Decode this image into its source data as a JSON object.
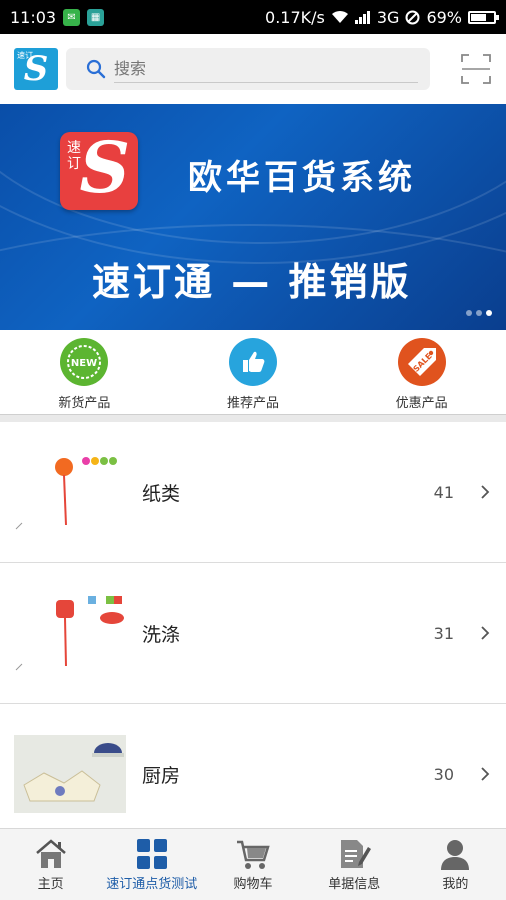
{
  "status_bar": {
    "time": "11:03",
    "speed": "0.17K/s",
    "network": "3G",
    "battery_text": "69%",
    "battery_level": 0.69
  },
  "header": {
    "logo_small": "速订",
    "logo_letter": "S",
    "search_placeholder": "搜索"
  },
  "banner": {
    "logo_small": "速订",
    "logo_letter": "S",
    "title": "欧华百货系统",
    "subtitle": "速订通 — 推销版",
    "active_slide": 2
  },
  "categories": [
    {
      "label": "新货产品",
      "badge": "NEW",
      "color": "#5cb531"
    },
    {
      "label": "推荐产品",
      "badge": "thumbs-up",
      "color": "#27a4dd"
    },
    {
      "label": "优惠产品",
      "badge": "SALE",
      "color": "#e0531e"
    }
  ],
  "list": [
    {
      "name": "纸类",
      "count": "41"
    },
    {
      "name": "洗涤",
      "count": "31"
    },
    {
      "name": "厨房",
      "count": "30"
    }
  ],
  "bottom_nav": [
    {
      "label": "主页",
      "icon": "home-icon"
    },
    {
      "label": "速订通点货测试",
      "icon": "grid-icon",
      "active": true
    },
    {
      "label": "购物车",
      "icon": "cart-icon"
    },
    {
      "label": "单据信息",
      "icon": "document-icon"
    },
    {
      "label": "我的",
      "icon": "user-icon"
    }
  ]
}
